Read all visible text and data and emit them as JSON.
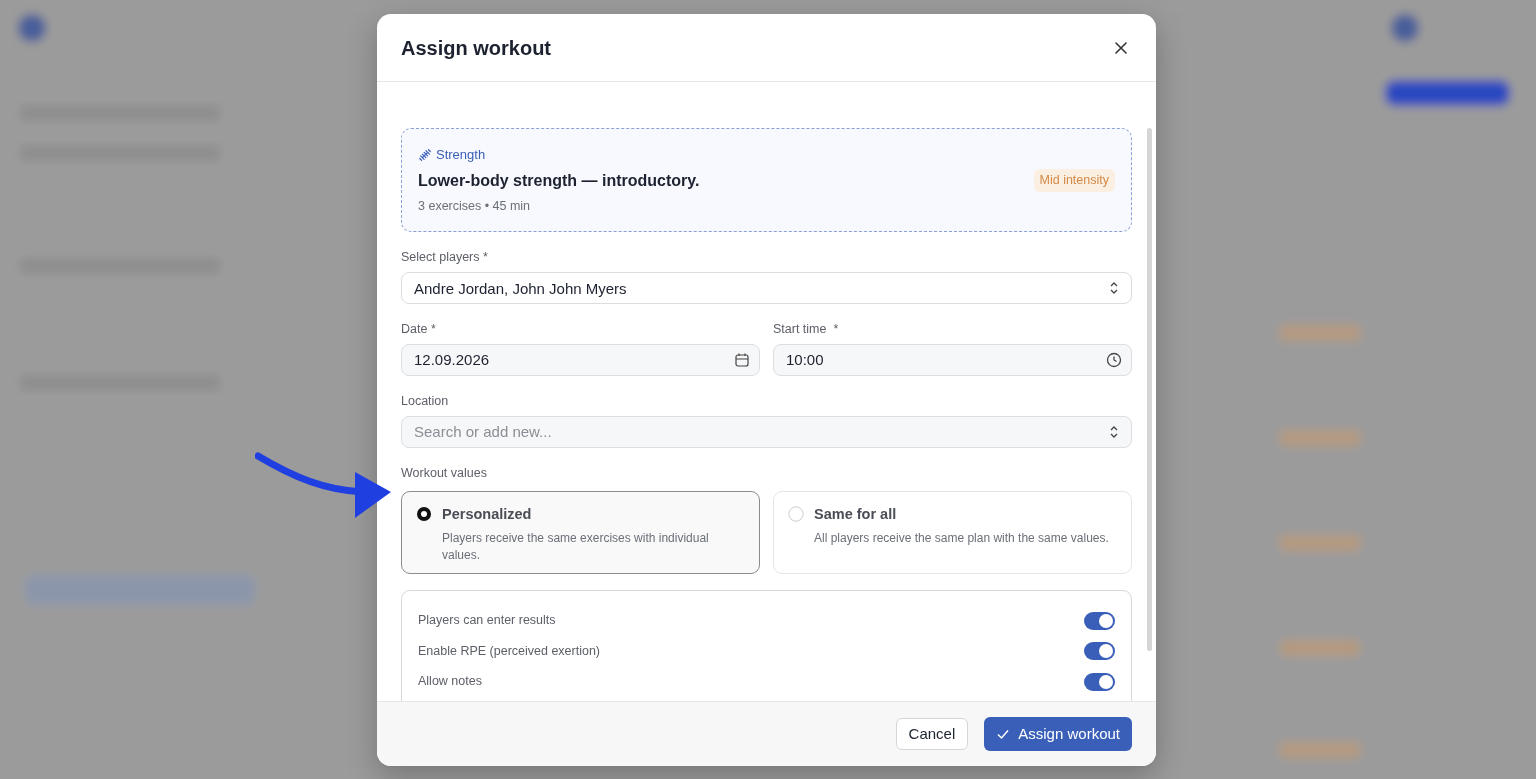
{
  "modal": {
    "title": "Assign workout"
  },
  "workout": {
    "category": "Strength",
    "title": "Lower-body strength — introductory.",
    "meta": "3 exercises • 45 min",
    "intensity": "Mid intensity"
  },
  "players": {
    "label": "Select players *",
    "value": "Andre Jordan, John John Myers"
  },
  "date": {
    "label": "Date *",
    "value": "12.09.2026"
  },
  "start_time": {
    "label": "Start time  *",
    "value": "10:00"
  },
  "location": {
    "label": "Location",
    "placeholder": "Search or add new..."
  },
  "workout_values": {
    "label": "Workout values",
    "options": [
      {
        "title": "Personalized",
        "description": "Players receive the same exercises with individual values.",
        "selected": true
      },
      {
        "title": "Same for all",
        "description": "All players receive the same plan with the same values.",
        "selected": false
      }
    ]
  },
  "settings": [
    {
      "label": "Players can enter results",
      "on": true
    },
    {
      "label": "Enable RPE (perceived exertion)",
      "on": true
    },
    {
      "label": "Allow notes",
      "on": true
    }
  ],
  "buttons": {
    "cancel": "Cancel",
    "assign": "Assign workout"
  }
}
